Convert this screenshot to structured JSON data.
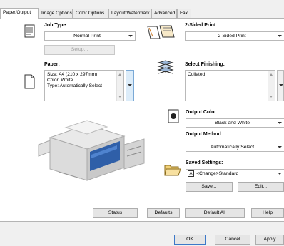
{
  "tabs": [
    {
      "label": "Paper/Output",
      "active": true
    },
    {
      "label": "Image Options"
    },
    {
      "label": "Color Options"
    },
    {
      "label": "Layout/Watermark"
    },
    {
      "label": "Advanced"
    },
    {
      "label": "Fax"
    }
  ],
  "job_type": {
    "label": "Job Type:",
    "value": "Normal Print",
    "setup_button": "Setup..."
  },
  "paper": {
    "label": "Paper:",
    "lines": [
      "Size: A4 (210 x 297mm)",
      "Color: White",
      "Type: Automatically Select"
    ]
  },
  "two_sided": {
    "label": "2-Sided Print:",
    "value": "2-Sided Print"
  },
  "finishing": {
    "label": "Select Finishing:",
    "value": "Collated"
  },
  "output_color": {
    "label": "Output Color:",
    "value": "Black and White"
  },
  "output_method": {
    "label": "Output Method:",
    "value": "Automatically Select"
  },
  "saved_settings": {
    "label": "Saved Settings:",
    "value": "<Change>Standard",
    "save_button": "Save...",
    "edit_button": "Edit..."
  },
  "bottom_buttons": {
    "status": "Status",
    "defaults": "Defaults",
    "default_all": "Default All",
    "help": "Help"
  },
  "dialog_buttons": {
    "ok": "OK",
    "cancel": "Cancel",
    "apply": "Apply"
  },
  "colors": {
    "accent": "#3c78c8",
    "background": "#cfe6f6"
  }
}
